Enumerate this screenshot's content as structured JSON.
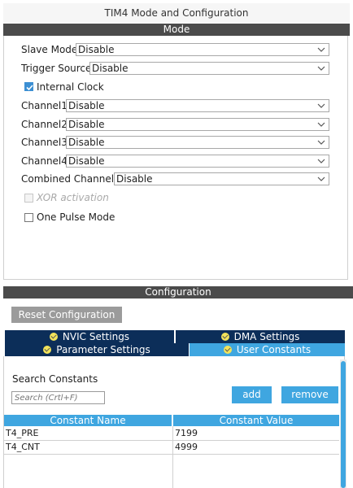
{
  "window": {
    "title": "TIM4 Mode and Configuration"
  },
  "mode": {
    "header": "Mode",
    "slave_mode": {
      "label": "Slave Mode",
      "value": "Disable"
    },
    "trigger_source": {
      "label": "Trigger Source",
      "value": "Disable"
    },
    "internal_clock": {
      "label": "Internal Clock",
      "checked": true
    },
    "channels": [
      {
        "label": "Channel1",
        "value": "Disable"
      },
      {
        "label": "Channel2",
        "value": "Disable"
      },
      {
        "label": "Channel3",
        "value": "Disable"
      },
      {
        "label": "Channel4",
        "value": "Disable"
      }
    ],
    "combined_channels": {
      "label": "Combined Channels",
      "value": "Disable"
    },
    "xor_activation": {
      "label": "XOR activation",
      "checked": false,
      "disabled": true
    },
    "one_pulse_mode": {
      "label": "One Pulse Mode",
      "checked": false
    }
  },
  "configuration": {
    "header": "Configuration",
    "reset_button": "Reset Configuration",
    "tabs": [
      {
        "label": "NVIC Settings",
        "active": false
      },
      {
        "label": "DMA Settings",
        "active": false
      },
      {
        "label": "Parameter Settings",
        "active": false
      },
      {
        "label": "User Constants",
        "active": true
      }
    ],
    "search": {
      "label": "Search Constants",
      "placeholder": "Search (Crtl+F)"
    },
    "add_button": "add",
    "remove_button": "remove",
    "table": {
      "columns": [
        "Constant Name",
        "Constant Value"
      ],
      "rows": [
        {
          "name": "T4_PRE",
          "value": "7199"
        },
        {
          "name": "T4_CNT",
          "value": "4999"
        }
      ]
    }
  },
  "colors": {
    "section_bar": "#4b4b4b",
    "tab_dark": "#0c2e59",
    "accent_blue": "#3fa6e0",
    "button_gray": "#9b9b9b"
  }
}
